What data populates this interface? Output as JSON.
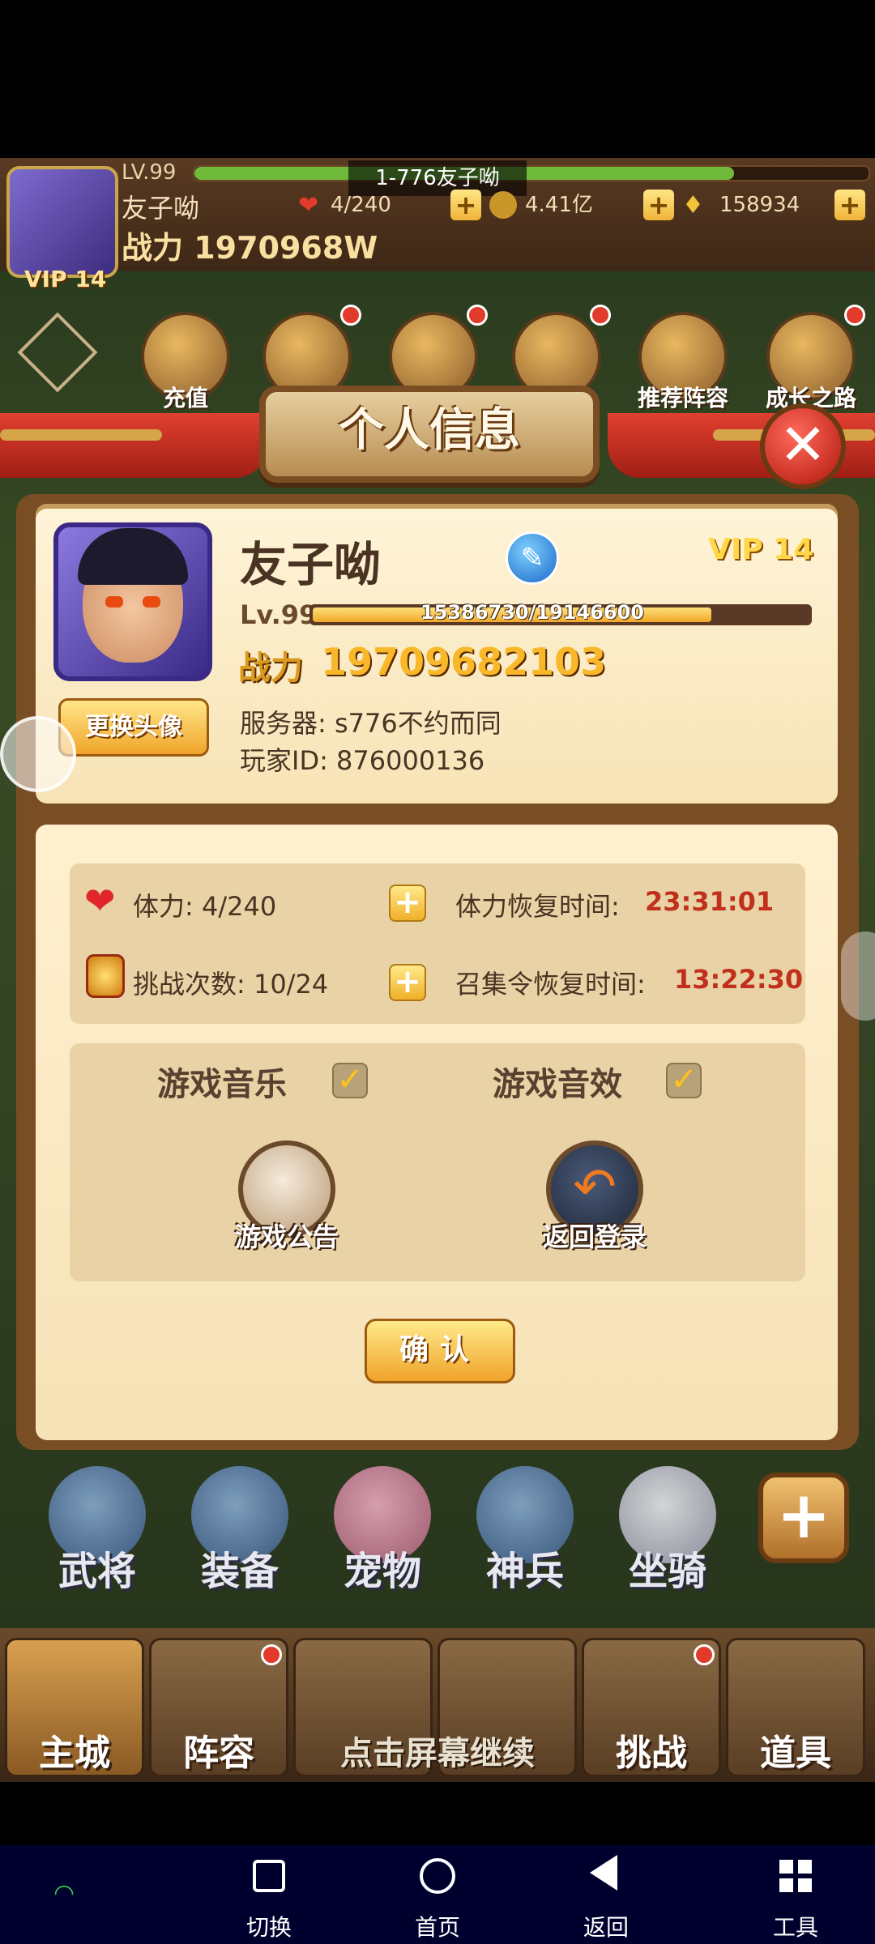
{
  "hud": {
    "level": "LV.99",
    "server_banner": "1-776友子呦",
    "name": "友子呦",
    "power": "战力 1970968W",
    "vip": "VIP 14",
    "stamina": "4/240",
    "gold": "4.41亿",
    "gems": "158934"
  },
  "top_icons": [
    {
      "label": "充值"
    },
    {
      "label": ""
    },
    {
      "label": ""
    },
    {
      "label": ""
    },
    {
      "label": "推荐阵容"
    },
    {
      "label": "成长之路"
    }
  ],
  "dialog": {
    "title": "个人信息",
    "player_name": "友子呦",
    "vip": "VIP 14",
    "level": "Lv.99",
    "exp_text": "15386730/19146600",
    "exp_progress": 0.8036,
    "power_label": "战力",
    "power_value": "19709682103",
    "change_avatar": "更换头像",
    "server": "服务器: s776不约而同",
    "player_id": "玩家ID: 876000136",
    "stamina_label": "体力: 4/240",
    "stamina_recover_label": "体力恢复时间:",
    "stamina_recover_time": "23:31:01",
    "challenge_label": "挑战次数: 10/24",
    "summon_recover_label": "召集令恢复时间:",
    "summon_recover_time": "13:22:30",
    "music_label": "游戏音乐",
    "sfx_label": "游戏音效",
    "music_on": true,
    "sfx_on": true,
    "notice_label": "游戏公告",
    "logout_label": "返回登录",
    "confirm_label": "确认"
  },
  "mid_icons": [
    "武将",
    "装备",
    "宠物",
    "神兵",
    "坐骑"
  ],
  "tabs": [
    "主城",
    "阵容",
    "",
    "",
    "挑战",
    "道具"
  ],
  "tap_hint": "点击屏幕继续",
  "system_nav": [
    "切换",
    "首页",
    "返回",
    "工具"
  ],
  "colors": {
    "accent_red": "#c0301c",
    "gold": "#f8b82a"
  }
}
